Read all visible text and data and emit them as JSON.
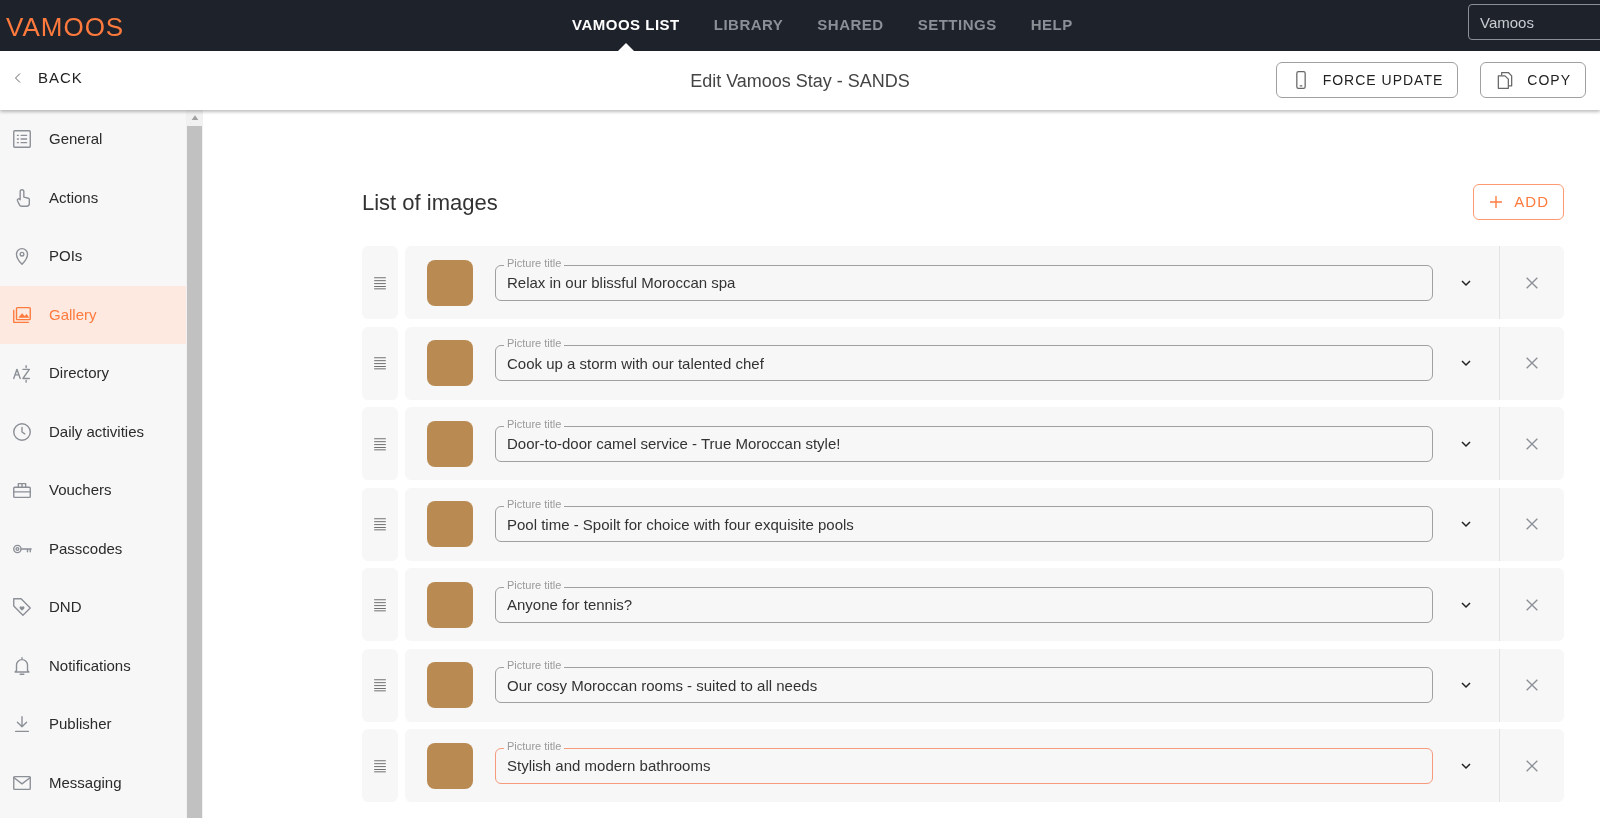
{
  "logo": "VAMOOS",
  "nav": [
    {
      "label": "VAMOOS LIST",
      "selected": true
    },
    {
      "label": "LIBRARY",
      "selected": false
    },
    {
      "label": "SHARED",
      "selected": false
    },
    {
      "label": "SETTINGS",
      "selected": false
    },
    {
      "label": "HELP",
      "selected": false
    }
  ],
  "operator_field": {
    "value": "Vamoos"
  },
  "toolbar": {
    "back": "BACK",
    "title": "Edit Vamoos Stay - SANDS",
    "buttons": [
      {
        "kind": "phone",
        "label": "FORCE UPDATE"
      },
      {
        "kind": "copy",
        "label": "COPY"
      }
    ]
  },
  "sidebar": {
    "items": [
      {
        "kind": "list",
        "label": "General",
        "selected": false
      },
      {
        "kind": "touch",
        "label": "Actions",
        "selected": false
      },
      {
        "kind": "pin",
        "label": "POIs",
        "selected": false
      },
      {
        "kind": "gallery",
        "label": "Gallery",
        "selected": true
      },
      {
        "kind": "az",
        "label": "Directory",
        "selected": false
      },
      {
        "kind": "clock",
        "label": "Daily activities",
        "selected": false
      },
      {
        "kind": "gift",
        "label": "Vouchers",
        "selected": false
      },
      {
        "kind": "key",
        "label": "Passcodes",
        "selected": false
      },
      {
        "kind": "tag",
        "label": "DND",
        "selected": false
      },
      {
        "kind": "bell",
        "label": "Notifications",
        "selected": false
      },
      {
        "kind": "download",
        "label": "Publisher",
        "selected": false
      },
      {
        "kind": "mail",
        "label": "Messaging",
        "selected": false
      }
    ]
  },
  "images": {
    "title": "List of images",
    "add_button": "ADD",
    "rows": [
      {
        "label": "Picture title",
        "value": "Relax in our blissful Moroccan spa",
        "focused": false
      },
      {
        "label": "Picture title",
        "value": "Cook up a storm with our talented chef",
        "focused": false
      },
      {
        "label": "Picture title",
        "value": "Door-to-door camel service - True Moroccan style!",
        "focused": false
      },
      {
        "label": "Picture title",
        "value": "Pool time - Spoilt for choice with four exquisite pools",
        "focused": false
      },
      {
        "label": "Picture title",
        "value": "Anyone for tennis?",
        "focused": false
      },
      {
        "label": "Picture title",
        "value": "Our cosy Moroccan rooms - suited to all needs",
        "focused": false
      },
      {
        "label": "Picture title",
        "value": "Stylish and modern bathrooms",
        "focused": true
      }
    ]
  }
}
